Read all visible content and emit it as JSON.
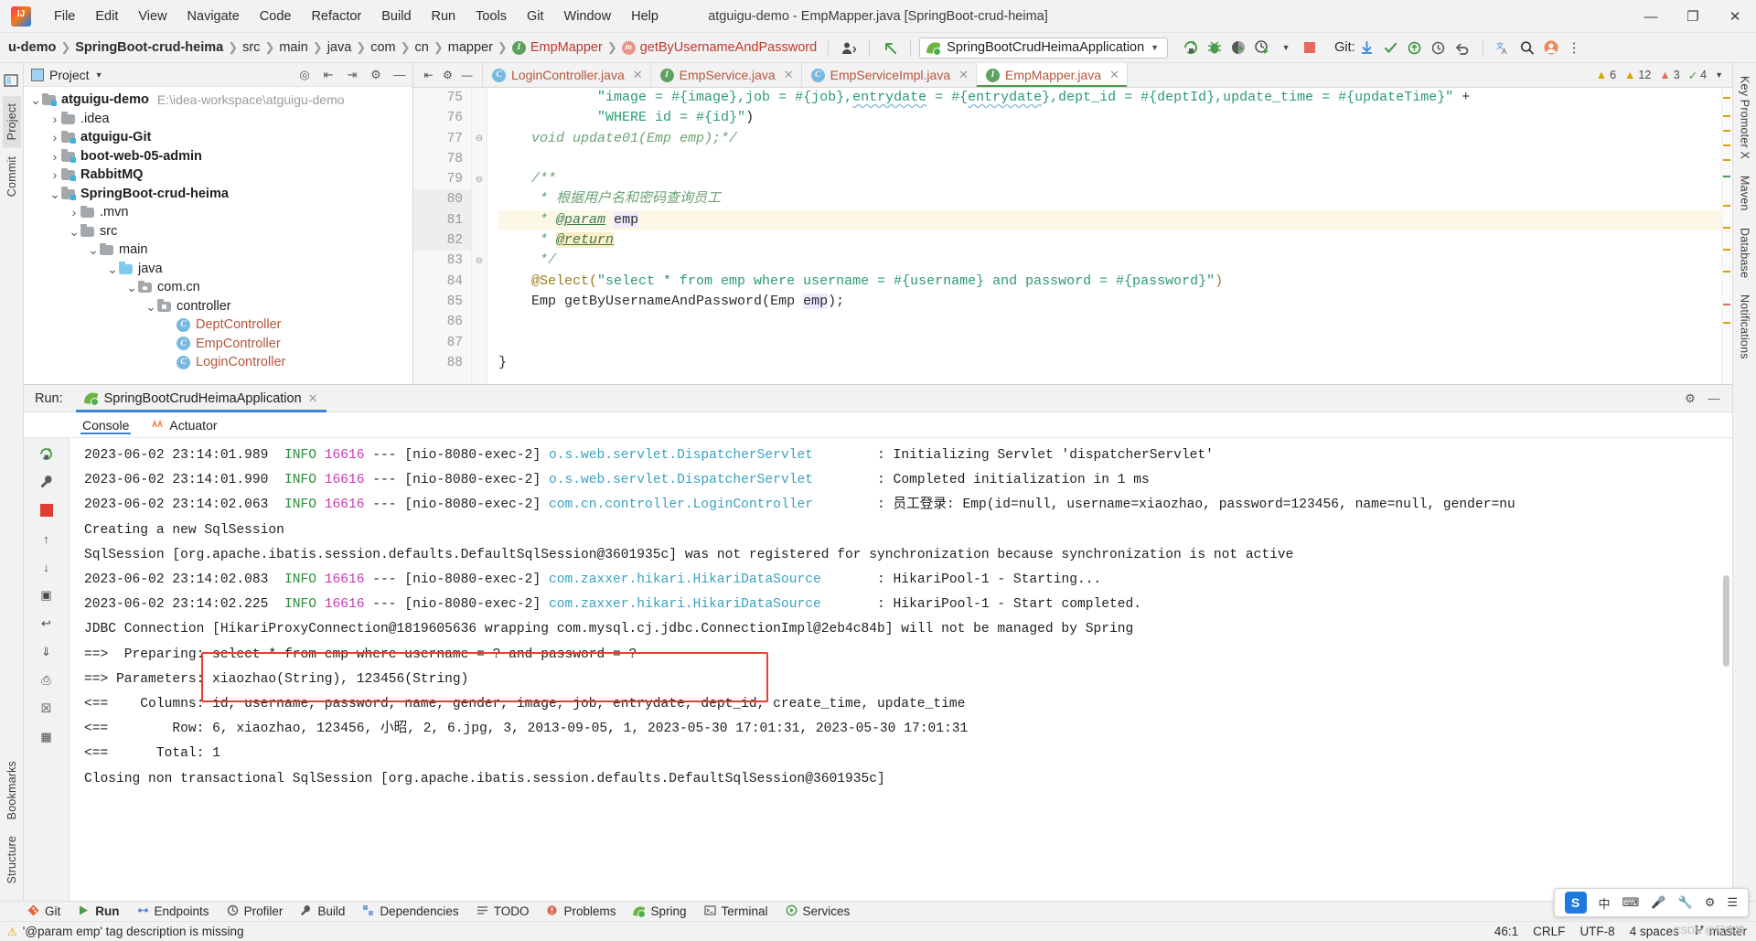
{
  "window": {
    "title": "atguigu-demo - EmpMapper.java [SpringBoot-crud-heima]",
    "minimize": "—",
    "maximize": "❐",
    "close": "✕"
  },
  "menubar": {
    "items": [
      "File",
      "Edit",
      "View",
      "Navigate",
      "Code",
      "Refactor",
      "Build",
      "Run",
      "Tools",
      "Git",
      "Window",
      "Help"
    ]
  },
  "navbar": {
    "breadcrumbs": [
      {
        "label": "u-demo",
        "bold": true,
        "icon": ""
      },
      {
        "label": "SpringBoot-crud-heima",
        "bold": true,
        "icon": ""
      },
      {
        "label": "src",
        "bold": false,
        "icon": ""
      },
      {
        "label": "main",
        "bold": false,
        "icon": ""
      },
      {
        "label": "java",
        "bold": false,
        "icon": ""
      },
      {
        "label": "com",
        "bold": false,
        "icon": ""
      },
      {
        "label": "cn",
        "bold": false,
        "icon": ""
      },
      {
        "label": "mapper",
        "bold": false,
        "icon": ""
      },
      {
        "label": "EmpMapper",
        "bold": false,
        "icon": "I",
        "red": true
      },
      {
        "label": "getByUsernameAndPassword",
        "bold": false,
        "icon": "m",
        "red": true
      }
    ],
    "run_config": "SpringBootCrudHeimaApplication",
    "git_label": "Git:",
    "icons": {
      "avatar": "user-icon",
      "back_arrow": "back-arrow-icon",
      "run": "run-icon",
      "debug": "debug-icon",
      "coverage": "run-with-coverage-icon",
      "profiler": "profiler-icon",
      "stop": "stop-icon",
      "update_project": "update-project-icon",
      "commit": "commit-icon",
      "push": "push-icon",
      "history": "history-icon",
      "undo": "undo-icon",
      "translate": "translate-icon",
      "search": "search-icon",
      "account": "account-icon",
      "more": "more-icon"
    }
  },
  "project": {
    "header_title": "Project",
    "tree": [
      {
        "depth": 0,
        "twist": "v",
        "icon": "module",
        "label": "atguigu-demo",
        "bold": true,
        "path": "E:\\idea-workspace\\atguigu-demo"
      },
      {
        "depth": 1,
        "twist": ">",
        "icon": "folder",
        "label": ".idea",
        "bold": false,
        "path": ""
      },
      {
        "depth": 1,
        "twist": ">",
        "icon": "module",
        "label": "atguigu-Git",
        "bold": true,
        "path": ""
      },
      {
        "depth": 1,
        "twist": ">",
        "icon": "module",
        "label": "boot-web-05-admin",
        "bold": true,
        "path": ""
      },
      {
        "depth": 1,
        "twist": ">",
        "icon": "module",
        "label": "RabbitMQ",
        "bold": true,
        "path": ""
      },
      {
        "depth": 1,
        "twist": "v",
        "icon": "module",
        "label": "SpringBoot-crud-heima",
        "bold": true,
        "path": ""
      },
      {
        "depth": 2,
        "twist": ">",
        "icon": "folder",
        "label": ".mvn",
        "bold": false,
        "path": ""
      },
      {
        "depth": 2,
        "twist": "v",
        "icon": "folder",
        "label": "src",
        "bold": false,
        "path": ""
      },
      {
        "depth": 3,
        "twist": "v",
        "icon": "folder",
        "label": "main",
        "bold": false,
        "path": ""
      },
      {
        "depth": 4,
        "twist": "v",
        "icon": "source",
        "label": "java",
        "bold": false,
        "path": ""
      },
      {
        "depth": 5,
        "twist": "v",
        "icon": "package",
        "label": "com.cn",
        "bold": false,
        "path": ""
      },
      {
        "depth": 6,
        "twist": "v",
        "icon": "package",
        "label": "controller",
        "bold": false,
        "path": ""
      },
      {
        "depth": 7,
        "twist": "",
        "icon": "class",
        "label": "DeptController",
        "bold": false,
        "path": ""
      },
      {
        "depth": 7,
        "twist": "",
        "icon": "class",
        "label": "EmpController",
        "bold": false,
        "path": ""
      },
      {
        "depth": 7,
        "twist": "",
        "icon": "class",
        "label": "LoginController",
        "bold": false,
        "path": ""
      }
    ]
  },
  "editor": {
    "tabs": [
      {
        "label": "LoginController.java",
        "icon": "C",
        "active": false
      },
      {
        "label": "EmpService.java",
        "icon": "I",
        "active": false
      },
      {
        "label": "EmpServiceImpl.java",
        "icon": "C",
        "active": false
      },
      {
        "label": "EmpMapper.java",
        "icon": "I",
        "active": true
      }
    ],
    "inspections": {
      "warnings": "6",
      "weak_warnings": "12",
      "errors": "3",
      "typos": "4"
    },
    "first_line_number": 75,
    "highlight_line": 81,
    "lines": [
      {
        "n": 75,
        "text": "            \"image = #{image},job = #{job},entrydate = #{entrydate},dept_id = #{deptId},update_time = #{updateTime}\" +"
      },
      {
        "n": 76,
        "text": "            \"WHERE id = #{id}\")"
      },
      {
        "n": 77,
        "text": "    void update01(Emp emp);*/"
      },
      {
        "n": 78,
        "text": ""
      },
      {
        "n": 79,
        "text": "    /**"
      },
      {
        "n": 80,
        "text": "     * 根据用户名和密码查询员工"
      },
      {
        "n": 81,
        "text": "     * @param emp"
      },
      {
        "n": 82,
        "text": "     * @return"
      },
      {
        "n": 83,
        "text": "     */"
      },
      {
        "n": 84,
        "text": "    @Select(\"select * from emp where username = #{username} and password = #{password}\")"
      },
      {
        "n": 85,
        "text": "    Emp getByUsernameAndPassword(Emp emp);"
      },
      {
        "n": 86,
        "text": ""
      },
      {
        "n": 87,
        "text": ""
      },
      {
        "n": 88,
        "text": "}"
      }
    ]
  },
  "run_panel": {
    "label": "Run:",
    "tab_title": "SpringBootCrudHeimaApplication",
    "console_tabs": [
      {
        "label": "Console",
        "active": true
      },
      {
        "label": "Actuator",
        "active": false
      }
    ],
    "console_lines": [
      {
        "segments": [
          {
            "t": "2023-06-02 23:14:01.989 ",
            "c": "date"
          },
          {
            "t": " INFO ",
            "c": "info"
          },
          {
            "t": "16616",
            "c": "pid"
          },
          {
            "t": " --- [nio-8080-exec-2] ",
            "c": "plain"
          },
          {
            "t": "o.s.web.servlet.DispatcherServlet",
            "c": "logger"
          },
          {
            "t": "        : Initializing Servlet 'dispatcherServlet'",
            "c": "plain"
          }
        ]
      },
      {
        "segments": [
          {
            "t": "2023-06-02 23:14:01.990 ",
            "c": "date"
          },
          {
            "t": " INFO ",
            "c": "info"
          },
          {
            "t": "16616",
            "c": "pid"
          },
          {
            "t": " --- [nio-8080-exec-2] ",
            "c": "plain"
          },
          {
            "t": "o.s.web.servlet.DispatcherServlet",
            "c": "logger"
          },
          {
            "t": "        : Completed initialization in 1 ms",
            "c": "plain"
          }
        ]
      },
      {
        "segments": [
          {
            "t": "2023-06-02 23:14:02.063 ",
            "c": "date"
          },
          {
            "t": " INFO ",
            "c": "info"
          },
          {
            "t": "16616",
            "c": "pid"
          },
          {
            "t": " --- [nio-8080-exec-2] ",
            "c": "plain"
          },
          {
            "t": "com.cn.controller.LoginController",
            "c": "logger"
          },
          {
            "t": "        : 员工登录: Emp(id=null, username=xiaozhao, password=123456, name=null, gender=nu",
            "c": "plain"
          }
        ]
      },
      {
        "segments": [
          {
            "t": "Creating a new SqlSession",
            "c": "plain"
          }
        ]
      },
      {
        "segments": [
          {
            "t": "SqlSession [org.apache.ibatis.session.defaults.DefaultSqlSession@3601935c] was not registered for synchronization because synchronization is not active",
            "c": "plain"
          }
        ]
      },
      {
        "segments": [
          {
            "t": "2023-06-02 23:14:02.083 ",
            "c": "date"
          },
          {
            "t": " INFO ",
            "c": "info"
          },
          {
            "t": "16616",
            "c": "pid"
          },
          {
            "t": " --- [nio-8080-exec-2] ",
            "c": "plain"
          },
          {
            "t": "com.zaxxer.hikari.HikariDataSource",
            "c": "logger"
          },
          {
            "t": "       : HikariPool-1 - Starting...",
            "c": "plain"
          }
        ]
      },
      {
        "segments": [
          {
            "t": "2023-06-02 23:14:02.225 ",
            "c": "date"
          },
          {
            "t": " INFO ",
            "c": "info"
          },
          {
            "t": "16616",
            "c": "pid"
          },
          {
            "t": " --- [nio-8080-exec-2] ",
            "c": "plain"
          },
          {
            "t": "com.zaxxer.hikari.HikariDataSource",
            "c": "logger"
          },
          {
            "t": "       : HikariPool-1 - Start completed.",
            "c": "plain"
          }
        ]
      },
      {
        "segments": [
          {
            "t": "JDBC Connection [HikariProxyConnection@1819605636 wrapping com.mysql.cj.jdbc.ConnectionImpl@2eb4c84b] will not be managed by Spring",
            "c": "plain"
          }
        ]
      },
      {
        "segments": [
          {
            "t": "==>  Preparing: select * from emp where username = ? and password = ?",
            "c": "plain"
          }
        ]
      },
      {
        "segments": [
          {
            "t": "==> Parameters: xiaozhao(String), 123456(String)",
            "c": "plain"
          }
        ]
      },
      {
        "segments": [
          {
            "t": "<==    Columns: id, username, password, name, gender, image, job, entrydate, dept_id, create_time, update_time",
            "c": "plain"
          }
        ]
      },
      {
        "segments": [
          {
            "t": "<==        Row: 6, xiaozhao, 123456, 小昭, 2, 6.jpg, 3, 2013-09-05, 1, 2023-05-30 17:01:31, 2023-05-30 17:01:31",
            "c": "plain"
          }
        ]
      },
      {
        "segments": [
          {
            "t": "<==      Total: 1",
            "c": "plain"
          }
        ]
      },
      {
        "segments": [
          {
            "t": "",
            "c": "plain"
          }
        ]
      },
      {
        "segments": [
          {
            "t": "Closing non transactional SqlSession [org.apache.ibatis.session.defaults.DefaultSqlSession@3601935c]",
            "c": "plain"
          }
        ]
      }
    ],
    "highlight_color": "#f23a2e"
  },
  "left_strip": {
    "items": [
      {
        "label": "Project",
        "active": true,
        "icon": "project-icon"
      },
      {
        "label": "Commit",
        "active": false,
        "icon": "commit-icon"
      },
      {
        "label": "Bookmarks",
        "active": false,
        "icon": "bookmarks-icon"
      },
      {
        "label": "Structure",
        "active": false,
        "icon": "structure-icon"
      }
    ]
  },
  "right_strip": {
    "items": [
      {
        "label": "Key Promoter X",
        "icon": "key-promoter-icon"
      },
      {
        "label": "Maven",
        "icon": "maven-icon"
      },
      {
        "label": "Database",
        "icon": "database-icon"
      },
      {
        "label": "Notifications",
        "icon": "notifications-icon"
      }
    ]
  },
  "bottom_bar": {
    "items": [
      {
        "label": "Git",
        "icon": "git-icon",
        "active": false
      },
      {
        "label": "Run",
        "icon": "run-icon",
        "active": true
      },
      {
        "label": "Endpoints",
        "icon": "endpoints-icon",
        "active": false
      },
      {
        "label": "Profiler",
        "icon": "profiler-icon",
        "active": false
      },
      {
        "label": "Build",
        "icon": "build-icon",
        "active": false
      },
      {
        "label": "Dependencies",
        "icon": "dependencies-icon",
        "active": false
      },
      {
        "label": "TODO",
        "icon": "todo-icon",
        "active": false
      },
      {
        "label": "Problems",
        "icon": "problems-icon",
        "active": false
      },
      {
        "label": "Spring",
        "icon": "spring-icon",
        "active": false
      },
      {
        "label": "Terminal",
        "icon": "terminal-icon",
        "active": false
      },
      {
        "label": "Services",
        "icon": "services-icon",
        "active": false
      }
    ]
  },
  "status_bar": {
    "message": "'@param emp' tag description is missing",
    "caret": "46:1",
    "line_separator": "CRLF",
    "encoding": "UTF-8",
    "indent": "4 spaces",
    "branch": "master"
  },
  "ime": {
    "logo": "S",
    "mode": "中",
    "items": [
      "keyboard-icon",
      "mic-icon",
      "toolbox-icon",
      "settings-icon",
      "menu-icon"
    ]
  },
  "watermark": "CSDN @程序猿"
}
